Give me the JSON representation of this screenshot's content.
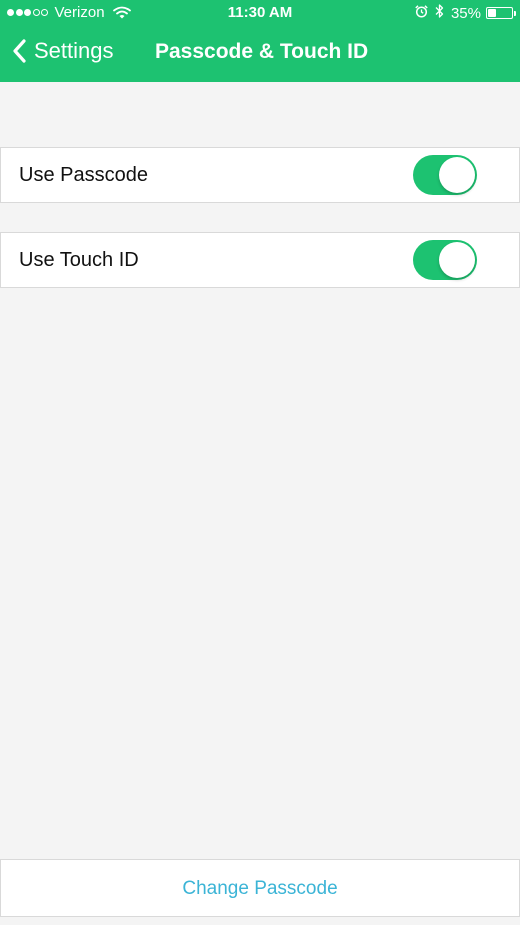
{
  "status_bar": {
    "carrier": "Verizon",
    "signal_filled_dots": 3,
    "signal_total_dots": 5,
    "time": "11:30 AM",
    "battery": "35%",
    "battery_level": 0.35,
    "icons": [
      "wifi-icon",
      "alarm-icon",
      "bluetooth-icon",
      "battery-icon"
    ]
  },
  "nav": {
    "back_label": "Settings",
    "title": "Passcode & Touch ID"
  },
  "settings": {
    "use_passcode": {
      "label": "Use Passcode",
      "enabled": true
    },
    "use_touch_id": {
      "label": "Use Touch ID",
      "enabled": true
    }
  },
  "change_passcode": {
    "label": "Change Passcode"
  },
  "colors": {
    "accent": "#1dc271",
    "link": "#3bb4d6",
    "background": "#f4f4f4"
  }
}
